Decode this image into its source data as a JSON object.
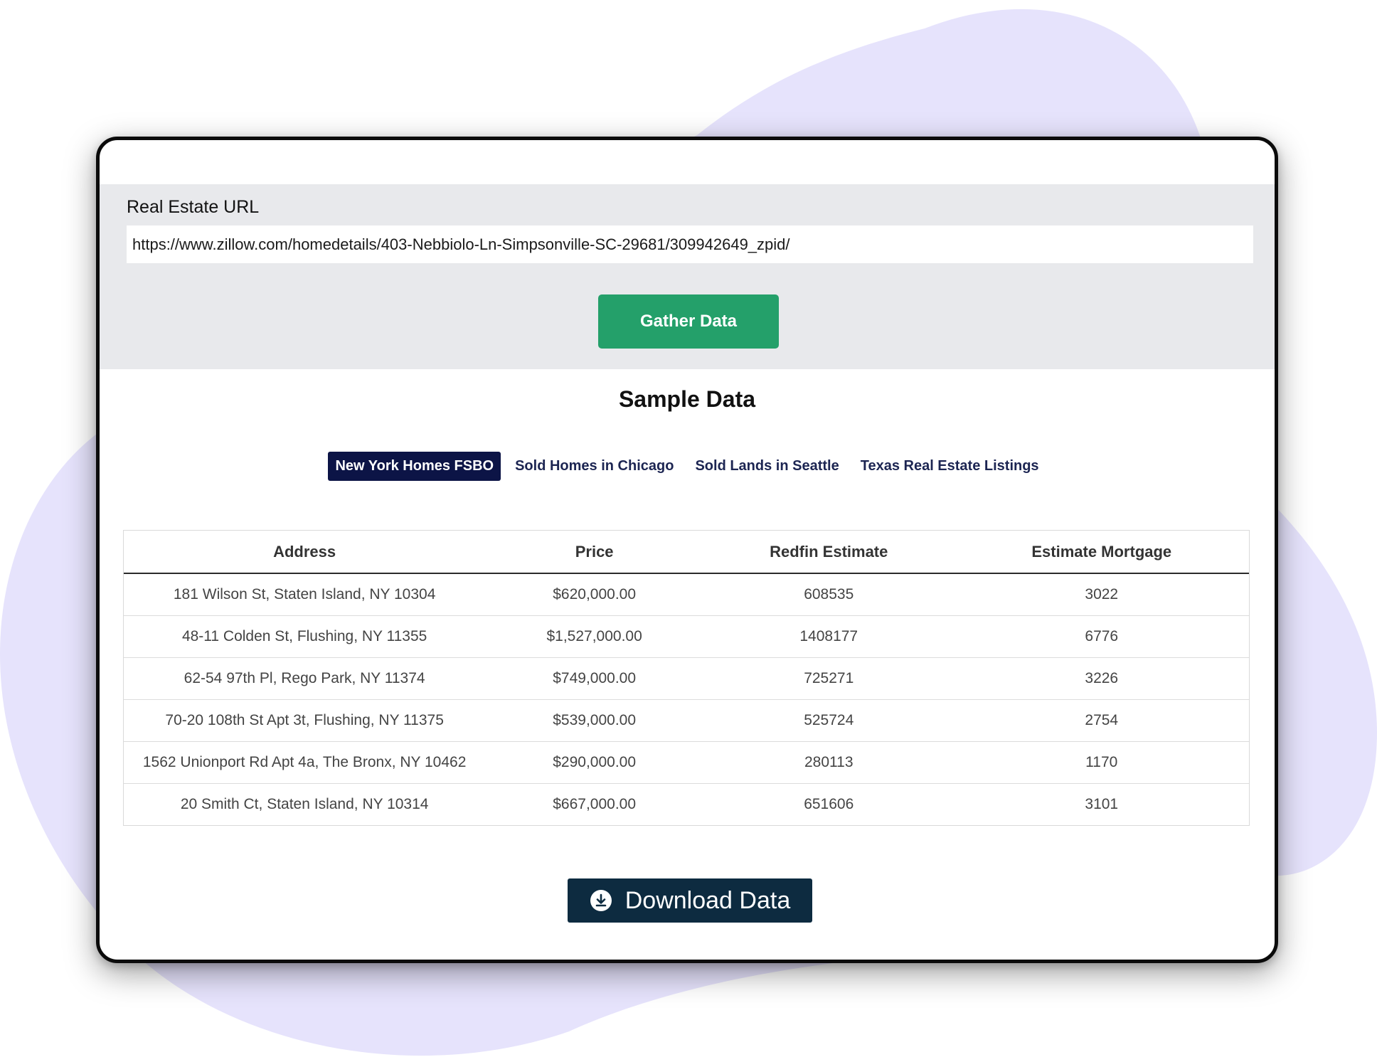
{
  "url_panel": {
    "label": "Real Estate URL",
    "url_value": "https://www.zillow.com/homedetails/403-Nebbiolo-Ln-Simpsonville-SC-29681/309942649_zpid/",
    "gather_label": "Gather Data"
  },
  "sample": {
    "title": "Sample Data",
    "tabs": [
      {
        "label": "New York Homes FSBO",
        "active": true
      },
      {
        "label": "Sold Homes in Chicago",
        "active": false
      },
      {
        "label": "Sold Lands in Seattle",
        "active": false
      },
      {
        "label": "Texas Real Estate Listings",
        "active": false
      }
    ]
  },
  "table": {
    "headers": [
      "Address",
      "Price",
      "Redfin Estimate",
      "Estimate Mortgage"
    ],
    "rows": [
      [
        "181 Wilson St, Staten Island, NY 10304",
        "$620,000.00",
        "608535",
        "3022"
      ],
      [
        "48-11 Colden St, Flushing, NY 11355",
        "$1,527,000.00",
        "1408177",
        "6776"
      ],
      [
        "62-54 97th Pl, Rego Park, NY 11374",
        "$749,000.00",
        "725271",
        "3226"
      ],
      [
        "70-20 108th St Apt 3t, Flushing, NY 11375",
        "$539,000.00",
        "525724",
        "2754"
      ],
      [
        "1562 Unionport Rd Apt 4a, The Bronx, NY 10462",
        "$290,000.00",
        "280113",
        "1170"
      ],
      [
        "20 Smith Ct, Staten Island, NY 10314",
        "$667,000.00",
        "651606",
        "3101"
      ]
    ]
  },
  "download": {
    "label": "Download Data",
    "icon": "download-circle-icon"
  },
  "colors": {
    "blob": "#e6e3fc",
    "gather": "#24a06a",
    "tab_active": "#0c1446",
    "download": "#0d2b40",
    "panel": "#e8e9ec"
  }
}
